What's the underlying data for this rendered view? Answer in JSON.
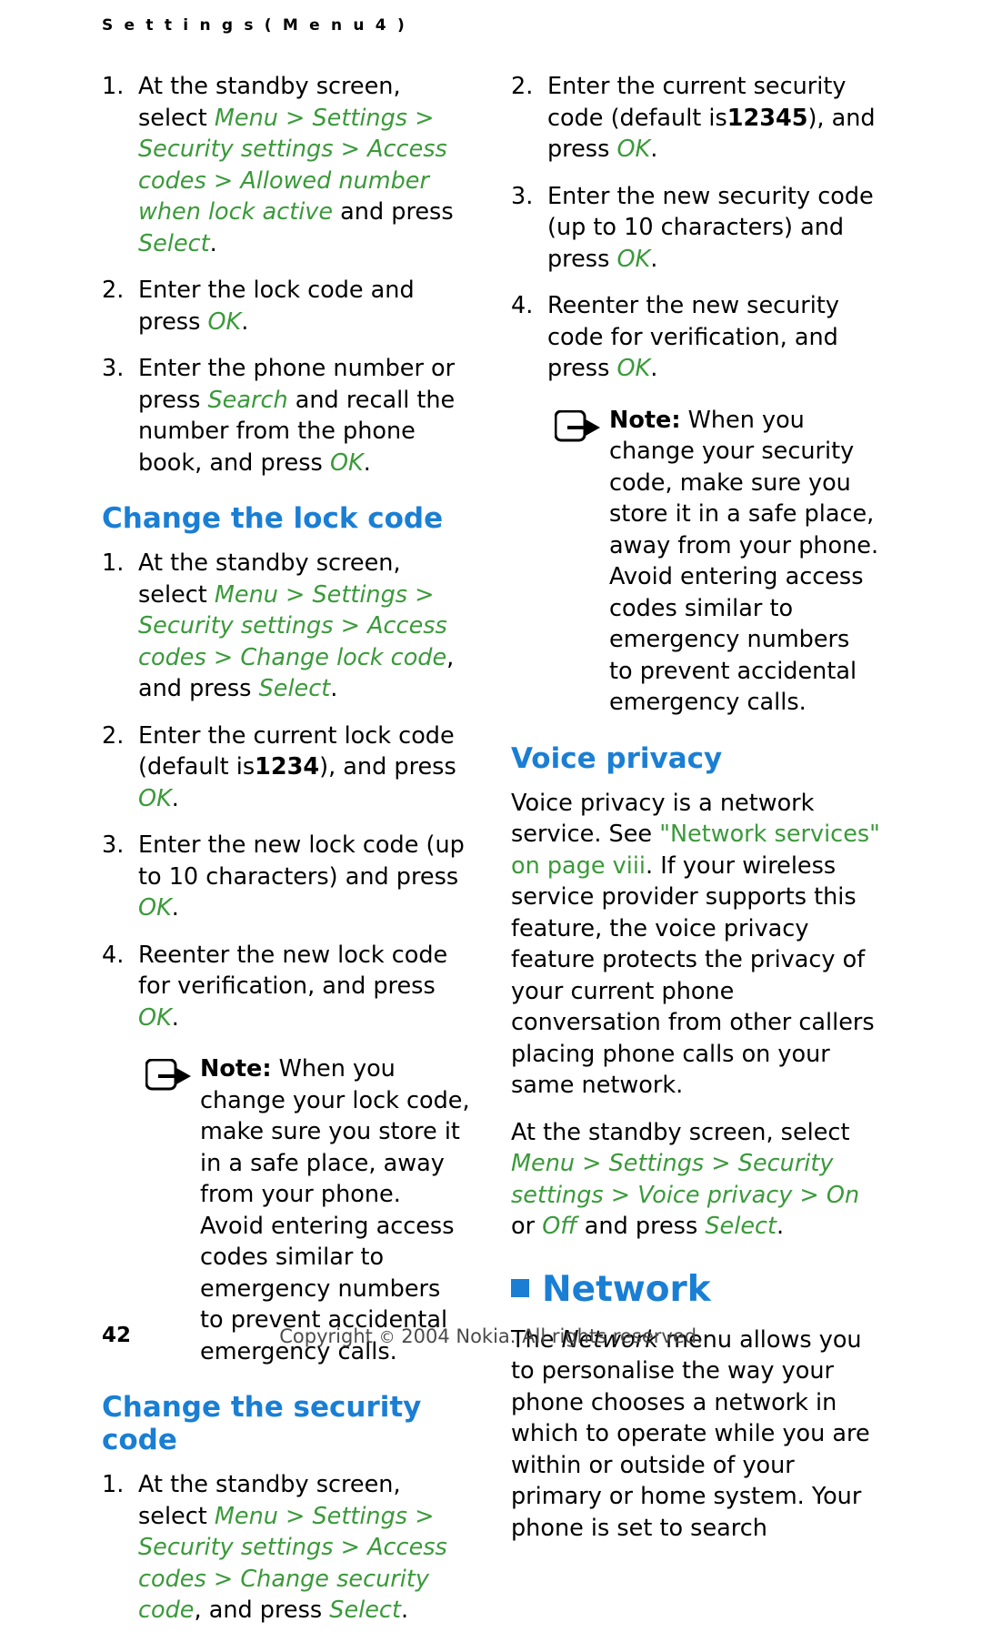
{
  "header": {
    "running_head": "S e t t i n g s   ( M e n u   4 )"
  },
  "colors": {
    "heading_blue": "#1a7fd4",
    "ui_green": "#3a9a3a",
    "body_black": "#000000"
  },
  "left_column": {
    "list_one": {
      "items": [
        {
          "num": "1.",
          "lead": "At the standby screen, select",
          "path": "Menu > Settings > Security settings > Access codes > Allowed number when lock active",
          "tail_pre": "and press",
          "tail_cmd": "Select",
          "tail_post": "."
        },
        {
          "num": "2.",
          "text_pre": "Enter the lock code and press",
          "cmd": "OK",
          "text_post": "."
        },
        {
          "num": "3.",
          "text_a": "Enter the phone number or press",
          "cmd1": "Search",
          "text_b": "and recall the number from the phone book, and press",
          "cmd2": "OK",
          "text_c": "."
        }
      ]
    },
    "heading_change_lock_code": "Change the lock code",
    "list_two": {
      "items": [
        {
          "num": "1.",
          "lead": "At the standby screen, select",
          "path": "Menu > Settings > Security settings > Access codes > Change lock code",
          "tail_pre": ", and press",
          "tail_cmd": "Select",
          "tail_post": "."
        },
        {
          "num": "2.",
          "text_a": "Enter the current lock code (default is",
          "value": "1234",
          "text_b": "), and press",
          "cmd": "OK",
          "text_c": "."
        },
        {
          "num": "3.",
          "text_a": "Enter the new lock code (up to 10 characters) and press",
          "cmd": "OK",
          "text_b": "."
        },
        {
          "num": "4.",
          "text_a": "Reenter the new lock code for verification, and press",
          "cmd": "OK",
          "text_b": "."
        }
      ]
    },
    "note": {
      "label": "Note:",
      "text": "When you change your lock code, make sure you store it in a safe place, away from your phone. Avoid entering access codes similar to emergency numbers to prevent accidental emergency calls."
    },
    "heading_change_security_code": "Change the security code",
    "list_three": {
      "items": [
        {
          "num": "1.",
          "lead": "At the standby screen, select",
          "path": "Menu > Settings > Security settings > Access codes > Change security code",
          "tail_pre": ", and press",
          "tail_cmd": "Select",
          "tail_post": "."
        }
      ]
    }
  },
  "right_column": {
    "list_one": {
      "items": [
        {
          "num": "2.",
          "text_a": "Enter the current security code (default is",
          "value": "12345",
          "text_b": "), and press",
          "cmd": "OK",
          "text_c": "."
        },
        {
          "num": "3.",
          "text_a": "Enter the new security code (up to 10 characters) and press",
          "cmd": "OK",
          "text_b": "."
        },
        {
          "num": "4.",
          "text_a": "Reenter the new security code for verification, and press",
          "cmd": "OK",
          "text_b": "."
        }
      ]
    },
    "note": {
      "label": "Note:",
      "text": "When you change your security code, make sure you store it in a safe place, away from your phone. Avoid entering access codes similar to emergency numbers to prevent accidental emergency calls."
    },
    "heading_voice_privacy": "Voice privacy",
    "voice_privacy": {
      "p1_a": "Voice privacy is a network service. See",
      "p1_link": "\"Network services\" on page viii",
      "p1_b": ". If your wireless service provider supports this feature, the voice privacy feature protects the privacy of your current phone conversation from other callers placing phone calls on your same network.",
      "p2_a": "At the standby screen, select",
      "p2_path": "Menu > Settings > Security settings > Voice privacy > On",
      "p2_or": "or",
      "p2_off": "Off",
      "p2_b": "and press",
      "p2_cmd": "Select",
      "p2_c": "."
    },
    "heading_network": "Network",
    "network": {
      "p1_a": "The",
      "p1_em": "Network",
      "p1_b": "menu allows you to personalise the way your phone chooses a network in which to operate while you are within or outside of your primary or home system. Your phone is set to search"
    }
  },
  "footer": {
    "page_number": "42",
    "copyright_pre": "Copyright",
    "copyright_mark": "©",
    "copyright_post": "2004 Nokia. All rights reserved."
  }
}
